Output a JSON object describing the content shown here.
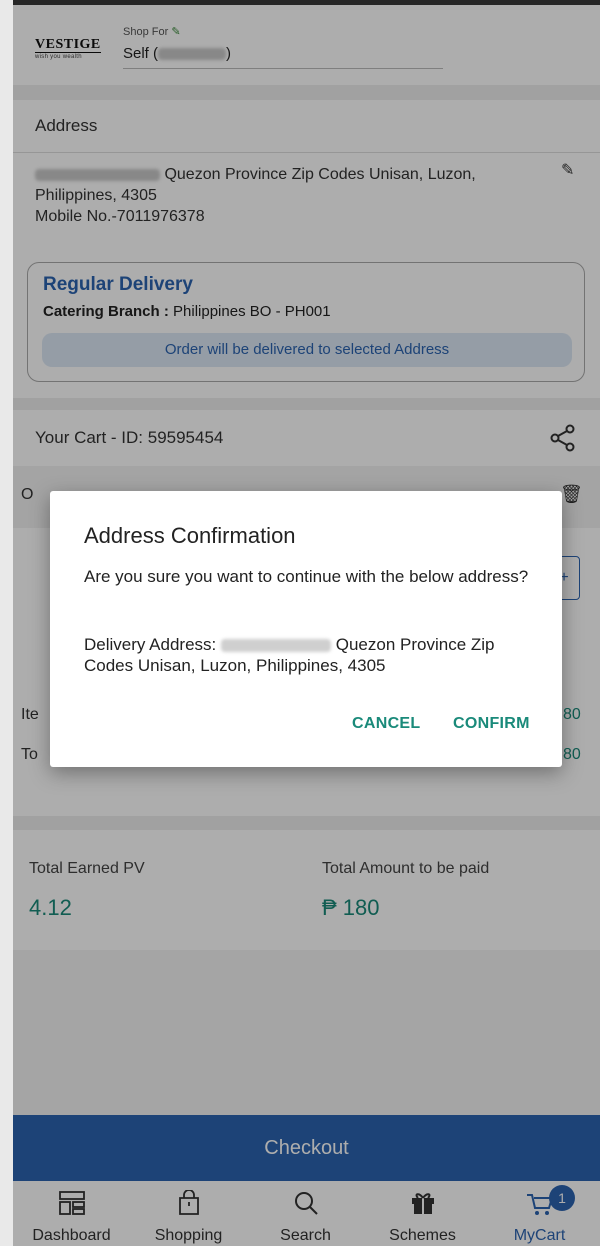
{
  "header": {
    "logo_text": "VESTIGE",
    "logo_tagline": "wish you wealth",
    "shop_for_label": "Shop For",
    "shop_for_value_prefix": "Self (",
    "shop_for_value_suffix": ")"
  },
  "address": {
    "title": "Address",
    "text": "Quezon Province Zip Codes Unisan, Luzon, Philippines, 4305",
    "mobile": "Mobile No.-7011976378"
  },
  "delivery": {
    "title": "Regular Delivery",
    "branch_label": "Catering Branch :",
    "branch_value": "Philippines BO - PH001",
    "note": "Order will be delivered to selected Address"
  },
  "cart": {
    "id_label": "Your Cart - ID: 59595454",
    "offers_partial": "O",
    "qty_partial": "+",
    "items_label_partial": "Ite",
    "items_value_partial": "80",
    "total_label_partial": "To",
    "total_value_partial": "80"
  },
  "summary": {
    "pv_label": "Total Earned PV",
    "pv_value": "4.12",
    "amount_label": "Total Amount to be paid",
    "amount_value": "₱ 180"
  },
  "checkout_label": "Checkout",
  "nav": {
    "items": [
      {
        "label": "Dashboard",
        "icon": "dashboard-icon"
      },
      {
        "label": "Shopping",
        "icon": "shopping-bag-icon"
      },
      {
        "label": "Search",
        "icon": "search-icon"
      },
      {
        "label": "Schemes",
        "icon": "gift-icon"
      },
      {
        "label": "MyCart",
        "icon": "cart-icon"
      }
    ],
    "cart_badge": "1"
  },
  "dialog": {
    "title": "Address Confirmation",
    "message": "Are you sure you want to continue with the below address?",
    "address_label": "Delivery Address:",
    "address_text": "Quezon Province Zip Codes Unisan, Luzon, Philippines, 4305",
    "cancel_label": "CANCEL",
    "confirm_label": "CONFIRM"
  },
  "colors": {
    "primary": "#2c64b0",
    "accent": "#1a8a7a"
  }
}
